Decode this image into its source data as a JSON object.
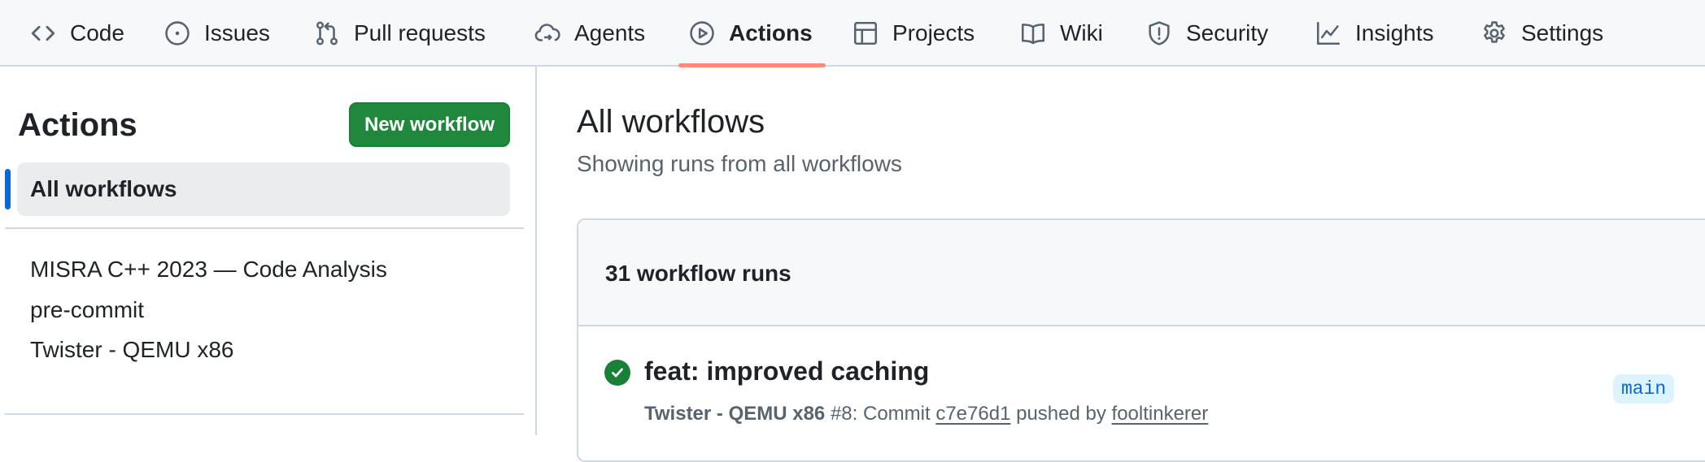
{
  "nav": {
    "tabs": [
      {
        "label": "Code",
        "icon": "code-icon"
      },
      {
        "label": "Issues",
        "icon": "issue-opened-icon"
      },
      {
        "label": "Pull requests",
        "icon": "git-pull-request-icon"
      },
      {
        "label": "Agents",
        "icon": "agent-cloud-icon"
      },
      {
        "label": "Actions",
        "icon": "play-icon",
        "active": true
      },
      {
        "label": "Projects",
        "icon": "table-icon"
      },
      {
        "label": "Wiki",
        "icon": "book-icon"
      },
      {
        "label": "Security",
        "icon": "shield-icon"
      },
      {
        "label": "Insights",
        "icon": "graph-icon"
      },
      {
        "label": "Settings",
        "icon": "gear-icon"
      }
    ],
    "active_underline_color": "#fd8c73"
  },
  "sidebar": {
    "title": "Actions",
    "new_workflow_label": "New workflow",
    "active_item": "All workflows",
    "workflows": [
      "MISRA C++ 2023 — Code Analysis",
      "pre-commit",
      "Twister - QEMU x86"
    ]
  },
  "main": {
    "title": "All workflows",
    "subtitle": "Showing runs from all workflows",
    "runs_count_label": "31 workflow runs",
    "runs": [
      {
        "status": "success",
        "title": "feat: improved caching",
        "workflow": "Twister - QEMU x86",
        "run_number": "#8",
        "event_prefix": ": Commit",
        "commit": "c7e76d1",
        "pushed_by_label": "pushed by",
        "author": "fooltinkerer",
        "branch": "main"
      }
    ]
  },
  "colors": {
    "primary_button": "#1f883d",
    "success": "#1a7f37",
    "accent_marker": "#0969da",
    "branch_bg": "#ddf4ff"
  }
}
